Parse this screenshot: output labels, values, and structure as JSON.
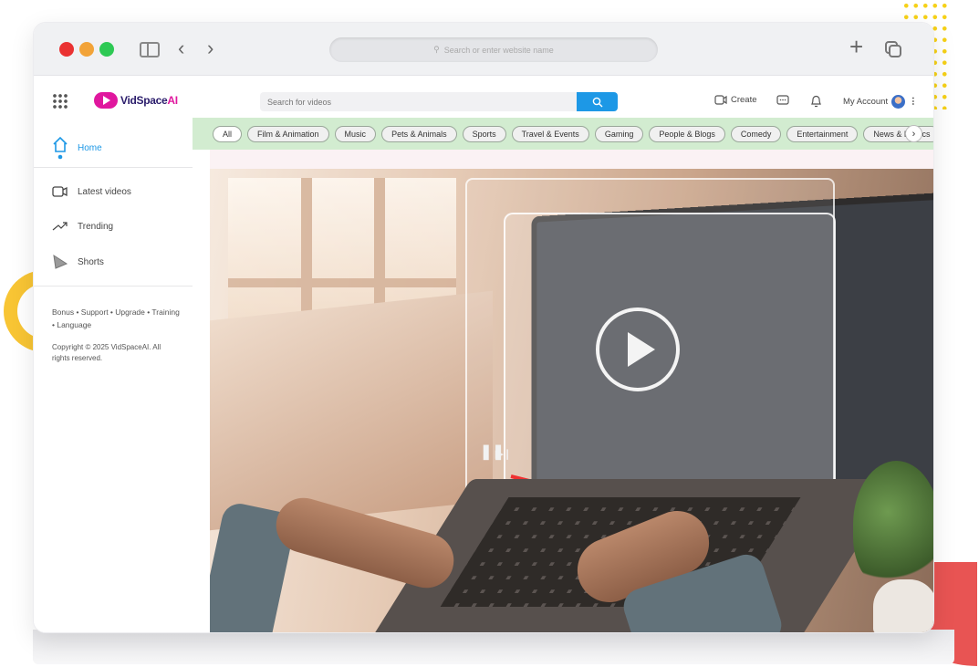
{
  "browser": {
    "url_placeholder": "Search or enter website name"
  },
  "app": {
    "logo_text": "VidSpace",
    "logo_suffix": "AI",
    "search_placeholder": "Search for videos",
    "create_label": "Create",
    "account_label": "My Account"
  },
  "sidebar": {
    "items": [
      {
        "label": "Home",
        "icon": "home-icon",
        "active": true
      },
      {
        "label": "Latest videos",
        "icon": "video-camera-icon"
      },
      {
        "label": "Trending",
        "icon": "trending-icon"
      },
      {
        "label": "Shorts",
        "icon": "shorts-icon"
      }
    ],
    "links": "Bonus • Support • Upgrade • Training • Language",
    "copyright": "Copyright © 2025 VidSpaceAI. All rights reserved."
  },
  "chips": [
    "All",
    "Film & Animation",
    "Music",
    "Pets & Animals",
    "Sports",
    "Travel & Events",
    "Gaming",
    "People & Blogs",
    "Comedy",
    "Entertainment",
    "News & Politics"
  ],
  "colors": {
    "accent": "#1d98e6",
    "brand": "#e0179e",
    "chip_bar": "#d2ecd0"
  },
  "hero": {
    "video_progress": 0.38
  }
}
